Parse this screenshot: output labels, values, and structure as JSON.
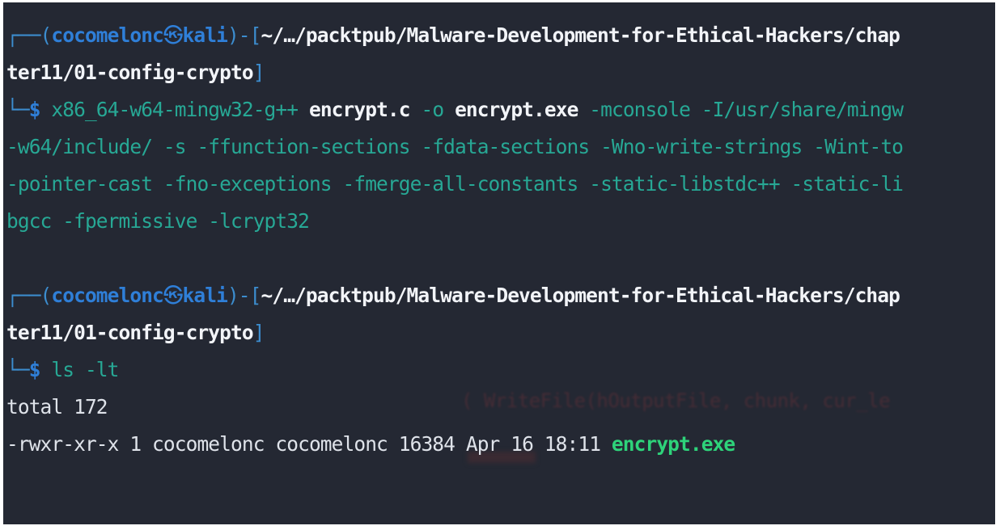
{
  "colors": {
    "background": "#242833",
    "frame": "#3c8dcf",
    "prompt": "#2f7fd8",
    "command": "#27a895",
    "executable": "#2ed37a"
  },
  "block1": {
    "frame_top": "┌──(",
    "user": "cocomelonc",
    "skull": "㉿",
    "host": "kali",
    "frame_mid": ")-[",
    "path_part1": "~/…/packtpub/Malware-Development-for-Ethical-Hackers/chap",
    "path_part2": "ter11/01-config-crypto",
    "frame_end": "]",
    "frame_bottom": "└─",
    "prompt_symbol": "$ ",
    "command": "x86_64-w64-mingw32-g++",
    "arg_source": "encrypt.c",
    "flag_output": "-o",
    "arg_output": "encrypt.exe",
    "args_line1": "-mconsole -I/usr/share/mingw",
    "args_line2": "-w64/include/ -s -ffunction-sections -fdata-sections -Wno-write-strings -Wint-to",
    "args_line3": "-pointer-cast -fno-exceptions -fmerge-all-constants -static-libstdc++ -static-li",
    "args_line4": "bgcc -fpermissive -lcrypt32"
  },
  "block2": {
    "frame_top": "┌──(",
    "user": "cocomelonc",
    "skull": "㉿",
    "host": "kali",
    "frame_mid": ")-[",
    "path_part1": "~/…/packtpub/Malware-Development-for-Ethical-Hackers/chap",
    "path_part2": "ter11/01-config-crypto",
    "frame_end": "]",
    "frame_bottom": "└─",
    "prompt_symbol": "$ ",
    "command": "ls -lt"
  },
  "output": {
    "total": "total 172",
    "file_row_prefix": "-rwxr-xr-x 1 cocomelonc cocomelonc 16384 Apr 16 18:11 ",
    "file_row_name": "encrypt.exe"
  },
  "background_ghost_text": "( WriteFile(hOutputFile, chunk, cur_le"
}
